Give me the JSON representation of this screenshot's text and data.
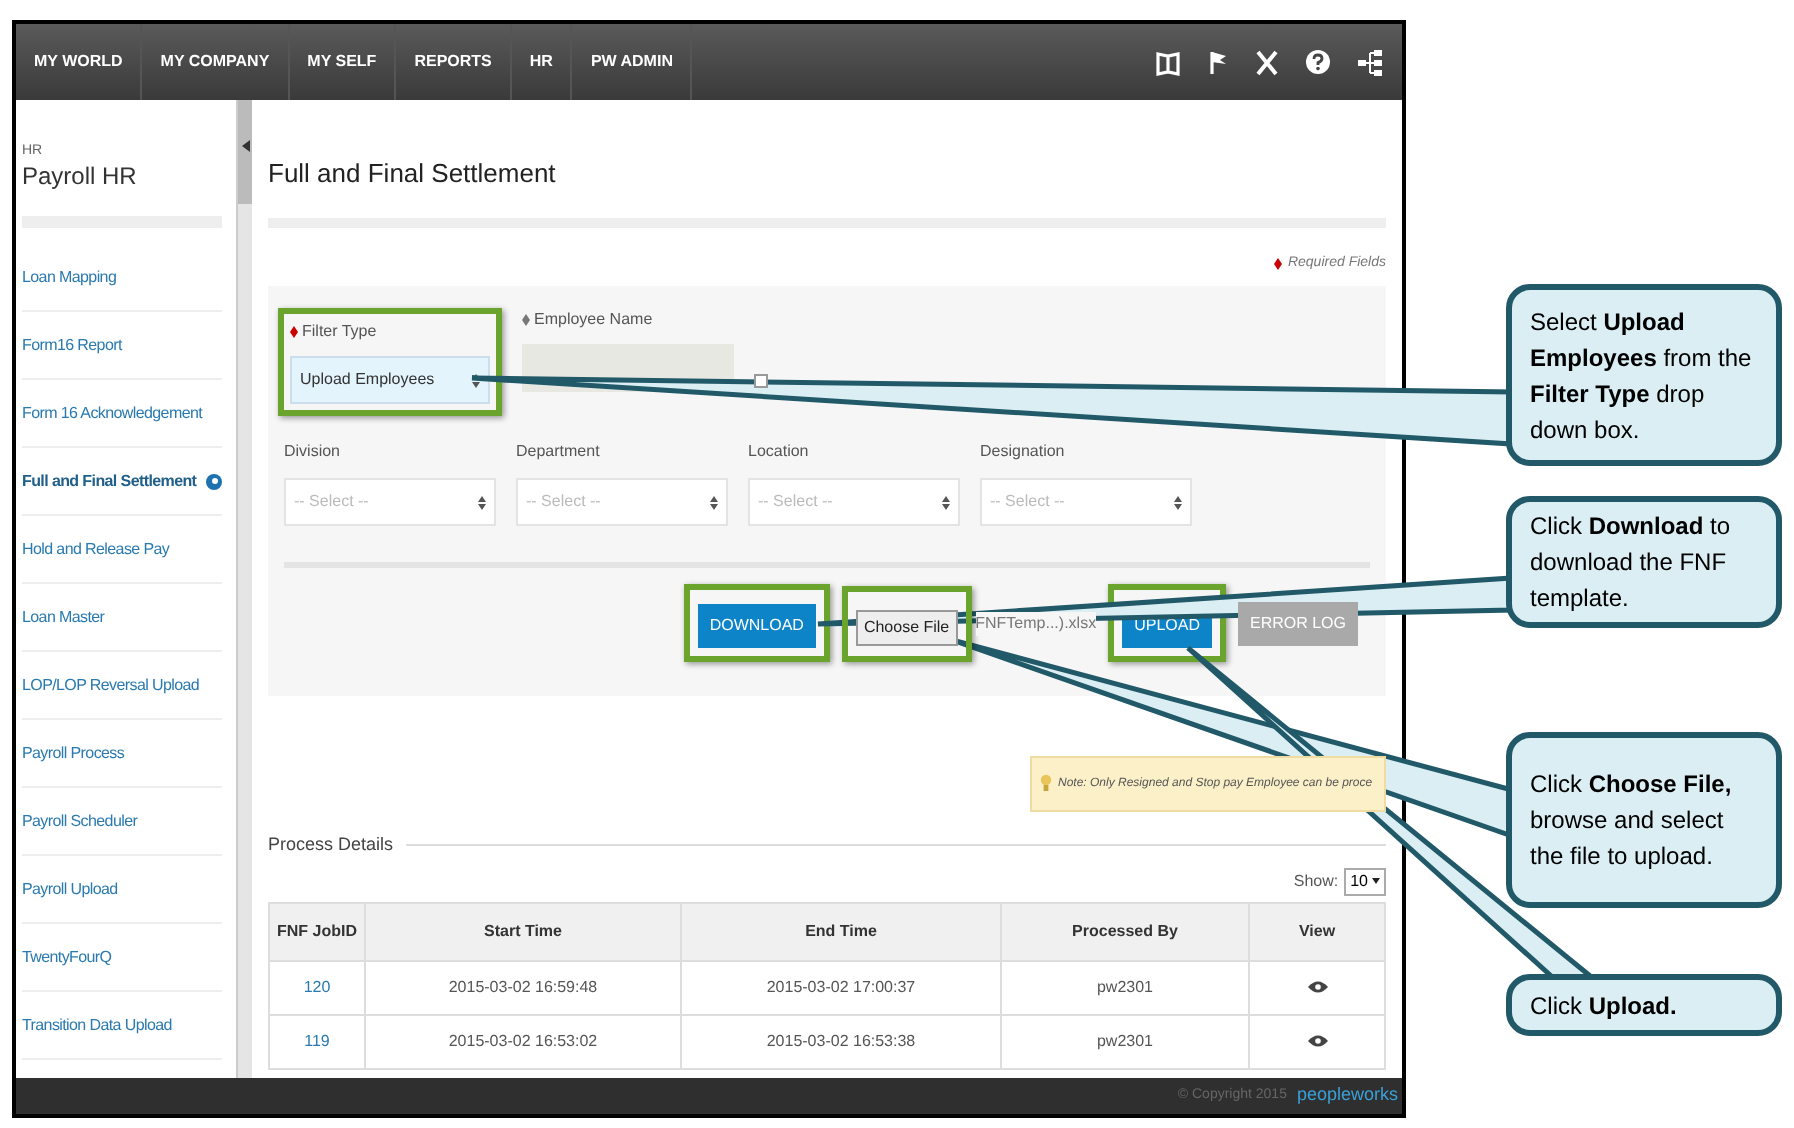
{
  "nav": {
    "items": [
      "MY WORLD",
      "MY COMPANY",
      "MY SELF",
      "REPORTS",
      "HR",
      "PW ADMIN"
    ]
  },
  "sidebar": {
    "section": "HR",
    "title": "Payroll HR",
    "items": [
      {
        "label": "Loan Mapping",
        "selected": false
      },
      {
        "label": "Form16 Report",
        "selected": false
      },
      {
        "label": "Form 16 Acknowledgement",
        "selected": false
      },
      {
        "label": "Full and Final Settlement",
        "selected": true
      },
      {
        "label": "Hold and Release Pay",
        "selected": false
      },
      {
        "label": "Loan Master",
        "selected": false
      },
      {
        "label": "LOP/LOP Reversal Upload",
        "selected": false
      },
      {
        "label": "Payroll Process",
        "selected": false
      },
      {
        "label": "Payroll Scheduler",
        "selected": false
      },
      {
        "label": "Payroll Upload",
        "selected": false
      },
      {
        "label": "TwentyFourQ",
        "selected": false
      },
      {
        "label": "Transition Data Upload",
        "selected": false
      }
    ]
  },
  "page_title": "Full and Final Settlement",
  "required_note": "Required Fields",
  "form": {
    "filter_type": {
      "label": "Filter Type",
      "value": "Upload Employees",
      "highlighted": true
    },
    "employee_name": {
      "label": "Employee Name",
      "checked": false
    },
    "selects": [
      {
        "label": "Division",
        "placeholder": "-- Select --"
      },
      {
        "label": "Department",
        "placeholder": "-- Select --"
      },
      {
        "label": "Location",
        "placeholder": "-- Select --"
      },
      {
        "label": "Designation",
        "placeholder": "-- Select --"
      }
    ],
    "download": {
      "label": "DOWNLOAD",
      "highlighted": true
    },
    "choose_file": {
      "label": "Choose File",
      "file_name": "FNFTemp...).xlsx",
      "highlighted": true
    },
    "upload": {
      "label": "UPLOAD",
      "highlighted": true
    },
    "error_log": {
      "label": "ERROR LOG",
      "disabled": true
    }
  },
  "note": "Note: Only Resigned and Stop pay Employee can be proce",
  "process_details": {
    "title": "Process Details",
    "show_label": "Show:",
    "show_value": "10",
    "columns": [
      "FNF JobID",
      "Start Time",
      "End Time",
      "Processed By",
      "View"
    ],
    "rows": [
      [
        "120",
        "2015-03-02 16:59:48",
        "2015-03-02 17:00:37",
        "pw2301"
      ],
      [
        "119",
        "2015-03-02 16:53:02",
        "2015-03-02 16:53:38",
        "pw2301"
      ]
    ]
  },
  "footer": {
    "copyright": "© Copyright 2015",
    "logo": "peopleworks"
  },
  "callouts": [
    "Select **Upload Employees** from the **Filter Type** drop down box.",
    "Click **Download** to download the FNF template.",
    "Click **Choose File,** browse and select the file to upload.",
    "Click **Upload.**"
  ]
}
